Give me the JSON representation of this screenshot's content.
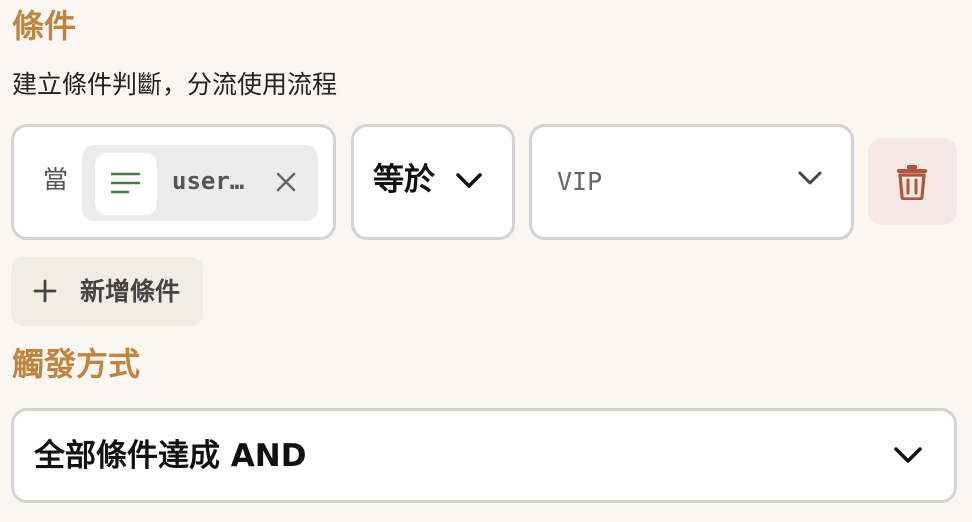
{
  "conditions": {
    "title": "條件",
    "description": "建立條件判斷，分流使用流程",
    "rows": [
      {
        "when_label": "當",
        "variable": {
          "name": "user…",
          "icon": "text-lines-icon"
        },
        "operator": "等於",
        "value": "VIP"
      }
    ],
    "add_label": "新增條件"
  },
  "trigger": {
    "title": "觸發方式",
    "selected": "全部條件達成 AND"
  },
  "colors": {
    "accent": "#c0843d",
    "delete": "#b0553a",
    "icon_green": "#4a7a4a",
    "background": "#faf6f1"
  }
}
